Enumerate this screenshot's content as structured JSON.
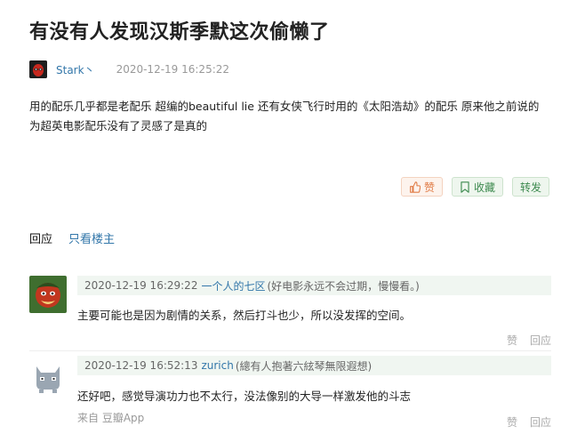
{
  "post": {
    "title": "有没有人发现汉斯季默这次偷懒了",
    "author": "Stark丶",
    "time": "2020-12-19 16:25:22",
    "content": "用的配乐几乎都是老配乐 超编的beautiful lie 还有女侠飞行时用的《太阳浩劫》的配乐 原来他之前说的为超英电影配乐没有了灵感了是真的"
  },
  "actions": {
    "like": "赞",
    "favorite": "收藏",
    "share": "转发"
  },
  "tabs": {
    "reply": "回应",
    "only_op": "只看楼主"
  },
  "comments": [
    {
      "time": "2020-12-19 16:29:22",
      "name": "一个人的七区",
      "signature": "(好电影永远不会过期，慢慢看。)",
      "text": "主要可能也是因为剧情的关系，然后打斗也少，所以没发挥的空间。",
      "like": "赞",
      "reply": "回应"
    },
    {
      "time": "2020-12-19 16:52:13",
      "name": "zurich",
      "signature": "(總有人抱著六絃琴無限遐想)",
      "text": "还好吧，感觉导演功力也不太行，没法像别的大导一样激发他的斗志",
      "from": "来自 豆瓣App",
      "like": "赞",
      "reply": "回应"
    }
  ],
  "colors": {
    "link": "#3377aa",
    "like_bg": "#fdf3ed",
    "like_fg": "#e07a44",
    "fav_bg": "#eef6ee",
    "fav_fg": "#3d8a4f",
    "comment_bar": "#f0f6f1"
  }
}
